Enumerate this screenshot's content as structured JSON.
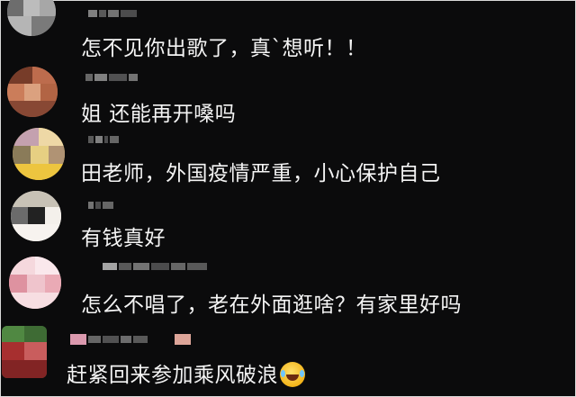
{
  "comments": [
    {
      "text": "怎不见你出歌了，真`想听！！",
      "avatar_colors": [
        "#8a8a8a",
        "#bcbcbc",
        "#6d6d6d",
        "#a7a7a7"
      ]
    },
    {
      "text": "姐 还能再开嗓吗",
      "avatar_colors": [
        "#a55a3c",
        "#d27b55",
        "#7c3b26",
        "#e0a07a"
      ]
    },
    {
      "text": "田老师，外国疫情严重，小心保护自己",
      "avatar_colors": [
        "#e7c04a",
        "#c7a0b0",
        "#8c7b55",
        "#f0d8a0"
      ]
    },
    {
      "text": "有钱真好",
      "avatar_colors": [
        "#f4f0ea",
        "#6b6b6b",
        "#222222",
        "#c9c2b5"
      ]
    },
    {
      "text": "怎么不唱了，老在外面逛啥？有家里好吗",
      "avatar_colors": [
        "#f0b6c0",
        "#f7d7dd",
        "#e590a0",
        "#fbe8ec"
      ]
    },
    {
      "text": "赶紧回来参加乘风破浪",
      "emoji": "rolling-laughing-emoji",
      "avatar_colors": [
        "#4c8a3c",
        "#b22c2c",
        "#2f5d28",
        "#d35a5a"
      ]
    }
  ],
  "username_color": "#8d8d8d",
  "background_color": "#0b0b0c"
}
